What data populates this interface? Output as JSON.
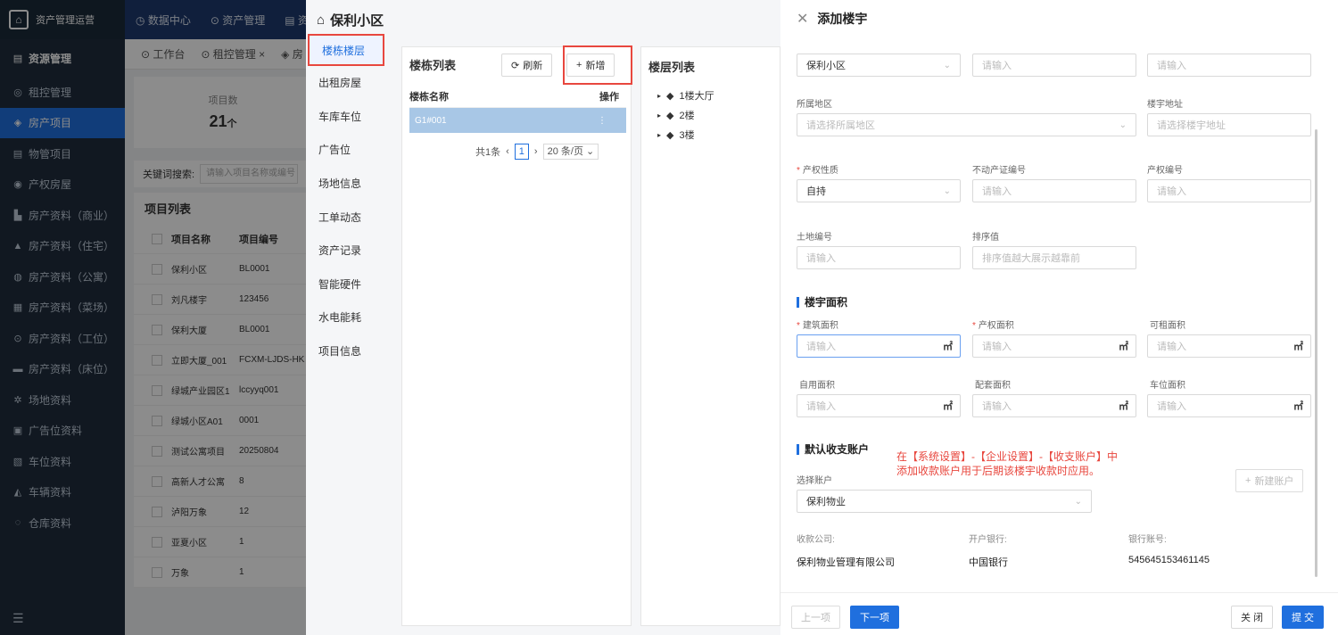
{
  "app": {
    "logo_text": "资产管理运营",
    "top_nav": [
      "数据中心",
      "资产管理",
      "资"
    ],
    "tabs": [
      "工作台",
      "租控管理 ×",
      "房"
    ],
    "sidebar": {
      "section": "资源管理",
      "items": [
        {
          "icon": "◎",
          "label": "租控管理"
        },
        {
          "icon": "◈",
          "label": "房产项目"
        },
        {
          "icon": "▤",
          "label": "物管项目"
        },
        {
          "icon": "◉",
          "label": "产权房屋"
        },
        {
          "icon": "▙",
          "label": "房产资料（商业）"
        },
        {
          "icon": "▲",
          "label": "房产资料（住宅）"
        },
        {
          "icon": "◍",
          "label": "房产资料（公寓）"
        },
        {
          "icon": "▦",
          "label": "房产资料（菜场）"
        },
        {
          "icon": "⊙",
          "label": "房产资料（工位）"
        },
        {
          "icon": "▬",
          "label": "房产资料（床位）"
        },
        {
          "icon": "✲",
          "label": "场地资料"
        },
        {
          "icon": "▣",
          "label": "广告位资料"
        },
        {
          "icon": "▧",
          "label": "车位资料"
        },
        {
          "icon": "◭",
          "label": "车辆资料"
        },
        {
          "icon": "◌",
          "label": "仓库资料"
        }
      ],
      "active_index": 1
    },
    "stat": {
      "label": "项目数",
      "value": "21",
      "unit": "个"
    },
    "search_label": "关键词搜索:",
    "search_placeholder": "请输入项目名称或编号",
    "list_title": "项目列表",
    "list_headers": [
      "项目名称",
      "项目编号"
    ],
    "list_rows": [
      [
        "保利小区",
        "BL0001"
      ],
      [
        "刘凡楼宇",
        "123456"
      ],
      [
        "保利大厦",
        "BL0001"
      ],
      [
        "立即大厦_001",
        "FCXM-LJDS-HK"
      ],
      [
        "绿城产业园区1",
        "lccyyq001"
      ],
      [
        "绿城小区A01",
        "0001"
      ],
      [
        "测试公寓项目",
        "20250804"
      ],
      [
        "高新人才公寓",
        "8"
      ],
      [
        "泸阳万象",
        "12"
      ],
      [
        "亚夏小区",
        "1"
      ],
      [
        "万象",
        "1"
      ]
    ]
  },
  "project": {
    "title": "保利小区",
    "menu": [
      "楼栋楼层",
      "出租房屋",
      "车库车位",
      "广告位",
      "场地信息",
      "工单动态",
      "资产记录",
      "智能硬件",
      "水电能耗",
      "项目信息"
    ],
    "active_menu": 0,
    "building_list": {
      "title": "楼栋列表",
      "refresh_label": "刷新",
      "add_label": "新增",
      "col_name": "楼栋名称",
      "col_op": "操作",
      "rows": [
        {
          "name": "G1#001",
          "op": "⋮"
        }
      ],
      "total_text": "共1条",
      "page": "1",
      "page_size": "20 条/页"
    },
    "floor_list": {
      "title": "楼层列表",
      "floors": [
        "1楼大厅",
        "2楼",
        "3楼"
      ]
    }
  },
  "add_building": {
    "title": "添加楼宇",
    "row1": {
      "project": "保利小区",
      "f2_placeholder": "请输入",
      "f3_placeholder": "请输入"
    },
    "region_label": "所属地区",
    "region_placeholder": "请选择所属地区",
    "address_label": "楼宇地址",
    "address_placeholder": "请选择楼宇地址",
    "property_nature_label": "产权性质",
    "property_nature_value": "自持",
    "real_estate_cert_label": "不动产证编号",
    "real_estate_cert_placeholder": "请输入",
    "property_no_label": "产权编号",
    "property_no_placeholder": "请输入",
    "land_no_label": "土地编号",
    "land_no_placeholder": "请输入",
    "sort_label": "排序值",
    "sort_placeholder": "排序值越大展示越靠前",
    "area_section": "楼宇面积",
    "area_fields": [
      {
        "label": "建筑面积",
        "required": "*",
        "placeholder": "请输入",
        "unit": "㎡"
      },
      {
        "label": "产权面积",
        "required": "*",
        "placeholder": "请输入",
        "unit": "㎡"
      },
      {
        "label": "可租面积",
        "required": "",
        "placeholder": "请输入",
        "unit": "㎡"
      },
      {
        "label": "自用面积",
        "required": "",
        "placeholder": "请输入",
        "unit": "㎡"
      },
      {
        "label": "配套面积",
        "required": "",
        "placeholder": "请输入",
        "unit": "㎡"
      },
      {
        "label": "车位面积",
        "required": "",
        "placeholder": "请输入",
        "unit": "㎡"
      }
    ],
    "account_section": "默认收支账户",
    "note_line1": "在【系统设置】-【企业设置】-【收支账户】中",
    "note_line2": "添加收款账户用于后期该楼宇收款时应用。",
    "select_account_label": "选择账户",
    "select_account_value": "保利物业",
    "new_account_label": "新建账户",
    "payee_label": "收款公司:",
    "payee_value": "保利物业管理有限公司",
    "bank_label": "开户银行:",
    "bank_value": "中国银行",
    "account_no_label": "银行账号:",
    "account_no_value": "545645153461145",
    "footer": {
      "prev": "上一项",
      "next": "下一项",
      "close": "关 闭",
      "submit": "提 交"
    }
  }
}
